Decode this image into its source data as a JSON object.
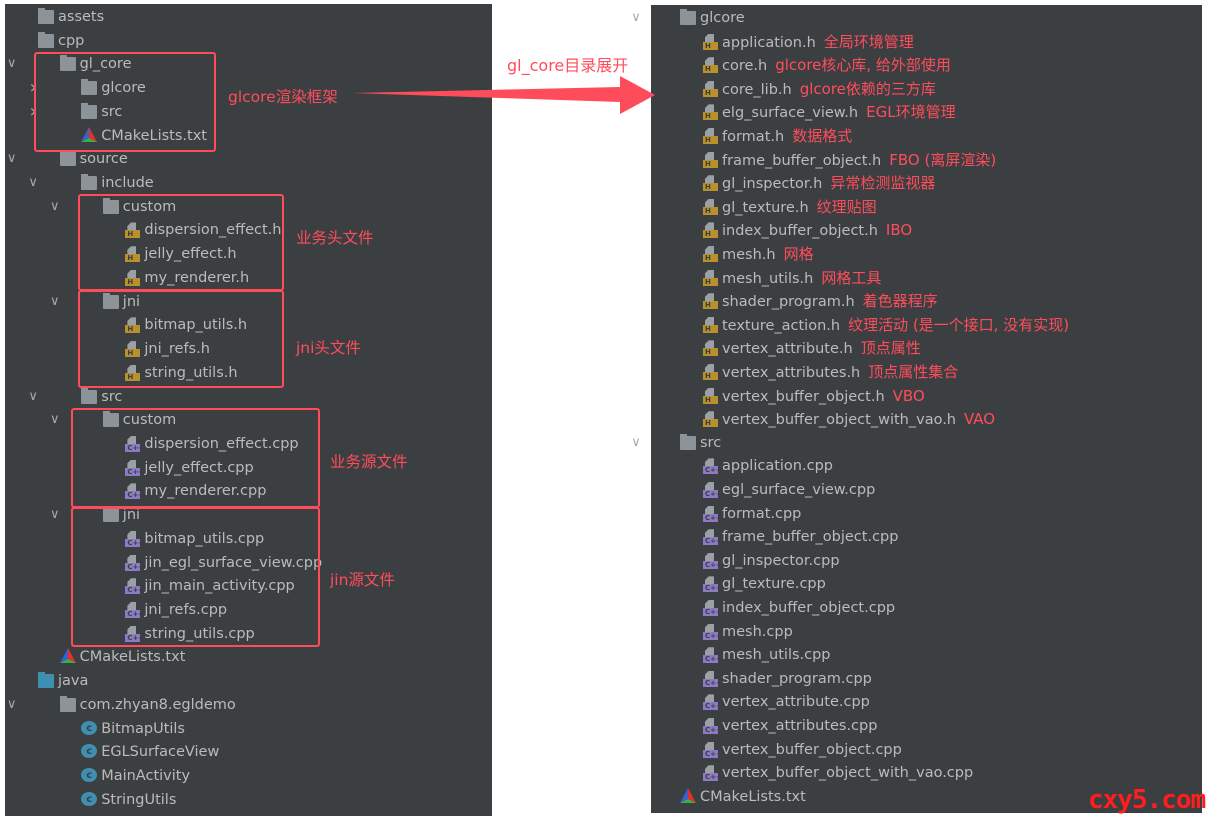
{
  "left_tree": [
    {
      "level": 0,
      "type": "folder-res",
      "name": "assets",
      "arrow": "collapsed"
    },
    {
      "level": 0,
      "type": "folder",
      "name": "cpp",
      "arrow": "expanded"
    },
    {
      "level": 1,
      "type": "folder",
      "name": "gl_core",
      "arrow": "expanded"
    },
    {
      "level": 2,
      "type": "folder",
      "name": "glcore",
      "arrow": "collapsed"
    },
    {
      "level": 2,
      "type": "folder",
      "name": "src",
      "arrow": "collapsed"
    },
    {
      "level": 2,
      "type": "cmake",
      "name": "CMakeLists.txt"
    },
    {
      "level": 1,
      "type": "folder",
      "name": "source",
      "arrow": "expanded"
    },
    {
      "level": 2,
      "type": "folder",
      "name": "include",
      "arrow": "expanded"
    },
    {
      "level": 3,
      "type": "folder",
      "name": "custom",
      "arrow": "expanded"
    },
    {
      "level": 4,
      "type": "h",
      "name": "dispersion_effect.h"
    },
    {
      "level": 4,
      "type": "h",
      "name": "jelly_effect.h"
    },
    {
      "level": 4,
      "type": "h",
      "name": "my_renderer.h"
    },
    {
      "level": 3,
      "type": "folder",
      "name": "jni",
      "arrow": "expanded"
    },
    {
      "level": 4,
      "type": "h",
      "name": "bitmap_utils.h"
    },
    {
      "level": 4,
      "type": "h",
      "name": "jni_refs.h"
    },
    {
      "level": 4,
      "type": "h",
      "name": "string_utils.h"
    },
    {
      "level": 2,
      "type": "folder",
      "name": "src",
      "arrow": "expanded"
    },
    {
      "level": 3,
      "type": "folder",
      "name": "custom",
      "arrow": "expanded"
    },
    {
      "level": 4,
      "type": "cpp",
      "name": "dispersion_effect.cpp"
    },
    {
      "level": 4,
      "type": "cpp",
      "name": "jelly_effect.cpp"
    },
    {
      "level": 4,
      "type": "cpp",
      "name": "my_renderer.cpp"
    },
    {
      "level": 3,
      "type": "folder",
      "name": "jni",
      "arrow": "expanded"
    },
    {
      "level": 4,
      "type": "cpp",
      "name": "bitmap_utils.cpp"
    },
    {
      "level": 4,
      "type": "cpp",
      "name": "jin_egl_surface_view.cpp"
    },
    {
      "level": 4,
      "type": "cpp",
      "name": "jin_main_activity.cpp"
    },
    {
      "level": 4,
      "type": "cpp",
      "name": "jni_refs.cpp"
    },
    {
      "level": 4,
      "type": "cpp",
      "name": "string_utils.cpp"
    },
    {
      "level": 1,
      "type": "cmake",
      "name": "CMakeLists.txt"
    },
    {
      "level": 0,
      "type": "folder-blue",
      "name": "java",
      "arrow": "expanded"
    },
    {
      "level": 1,
      "type": "package",
      "name": "com.zhyan8.egldemo",
      "arrow": "expanded"
    },
    {
      "level": 2,
      "type": "class",
      "name": "BitmapUtils"
    },
    {
      "level": 2,
      "type": "class",
      "name": "EGLSurfaceView"
    },
    {
      "level": 2,
      "type": "class",
      "name": "MainActivity"
    },
    {
      "level": 2,
      "type": "class",
      "name": "StringUtils"
    }
  ],
  "right_tree": [
    {
      "level": 0,
      "type": "folder",
      "name": "glcore",
      "arrow": "expanded"
    },
    {
      "level": 1,
      "type": "h",
      "name": "application.h",
      "note": "全局环境管理"
    },
    {
      "level": 1,
      "type": "h",
      "name": "core.h",
      "note": "glcore核心库, 给外部使用"
    },
    {
      "level": 1,
      "type": "h",
      "name": "core_lib.h",
      "note": "glcore依赖的三方库"
    },
    {
      "level": 1,
      "type": "h",
      "name": "elg_surface_view.h",
      "note": "EGL环境管理"
    },
    {
      "level": 1,
      "type": "h",
      "name": "format.h",
      "note": "数据格式"
    },
    {
      "level": 1,
      "type": "h",
      "name": "frame_buffer_object.h",
      "note": "FBO (离屏渲染)"
    },
    {
      "level": 1,
      "type": "h",
      "name": "gl_inspector.h",
      "note": "异常检测监视器"
    },
    {
      "level": 1,
      "type": "h",
      "name": "gl_texture.h",
      "note": "纹理贴图"
    },
    {
      "level": 1,
      "type": "h",
      "name": "index_buffer_object.h",
      "note": "IBO"
    },
    {
      "level": 1,
      "type": "h",
      "name": "mesh.h",
      "note": "网格"
    },
    {
      "level": 1,
      "type": "h",
      "name": "mesh_utils.h",
      "note": "网格工具"
    },
    {
      "level": 1,
      "type": "h",
      "name": "shader_program.h",
      "note": "着色器程序"
    },
    {
      "level": 1,
      "type": "h",
      "name": "texture_action.h",
      "note": "纹理活动 (是一个接口, 没有实现)"
    },
    {
      "level": 1,
      "type": "h",
      "name": "vertex_attribute.h",
      "note": "顶点属性"
    },
    {
      "level": 1,
      "type": "h",
      "name": "vertex_attributes.h",
      "note": "顶点属性集合"
    },
    {
      "level": 1,
      "type": "h",
      "name": "vertex_buffer_object.h",
      "note": "VBO"
    },
    {
      "level": 1,
      "type": "h",
      "name": "vertex_buffer_object_with_vao.h",
      "note": "VAO"
    },
    {
      "level": 0,
      "type": "folder",
      "name": "src",
      "arrow": "expanded"
    },
    {
      "level": 1,
      "type": "cpp",
      "name": "application.cpp"
    },
    {
      "level": 1,
      "type": "cpp",
      "name": "egl_surface_view.cpp"
    },
    {
      "level": 1,
      "type": "cpp",
      "name": "format.cpp"
    },
    {
      "level": 1,
      "type": "cpp",
      "name": "frame_buffer_object.cpp"
    },
    {
      "level": 1,
      "type": "cpp",
      "name": "gl_inspector.cpp"
    },
    {
      "level": 1,
      "type": "cpp",
      "name": "gl_texture.cpp"
    },
    {
      "level": 1,
      "type": "cpp",
      "name": "index_buffer_object.cpp"
    },
    {
      "level": 1,
      "type": "cpp",
      "name": "mesh.cpp"
    },
    {
      "level": 1,
      "type": "cpp",
      "name": "mesh_utils.cpp"
    },
    {
      "level": 1,
      "type": "cpp",
      "name": "shader_program.cpp"
    },
    {
      "level": 1,
      "type": "cpp",
      "name": "vertex_attribute.cpp"
    },
    {
      "level": 1,
      "type": "cpp",
      "name": "vertex_attributes.cpp"
    },
    {
      "level": 1,
      "type": "cpp",
      "name": "vertex_buffer_object.cpp"
    },
    {
      "level": 1,
      "type": "cpp",
      "name": "vertex_buffer_object_with_vao.cpp"
    },
    {
      "level": 0,
      "type": "cmake",
      "name": "CMakeLists.txt"
    }
  ],
  "annotations": {
    "glcore_framework": "glcore渲染框架",
    "business_headers": "业务头文件",
    "jni_headers": "jni头文件",
    "business_sources": "业务源文件",
    "jin_sources": "jin源文件",
    "arrow_label": "gl_core目录展开"
  },
  "watermark": "cxy5.com",
  "colors": {
    "panel_bg": "#3c3f41",
    "text": "#bbbbbb",
    "annotation": "#ff4c5b",
    "folder": "#8c9399",
    "java_folder": "#3e8fb0",
    "header_tag": "#b8902c",
    "cpp_tag": "#8b7bc4"
  }
}
